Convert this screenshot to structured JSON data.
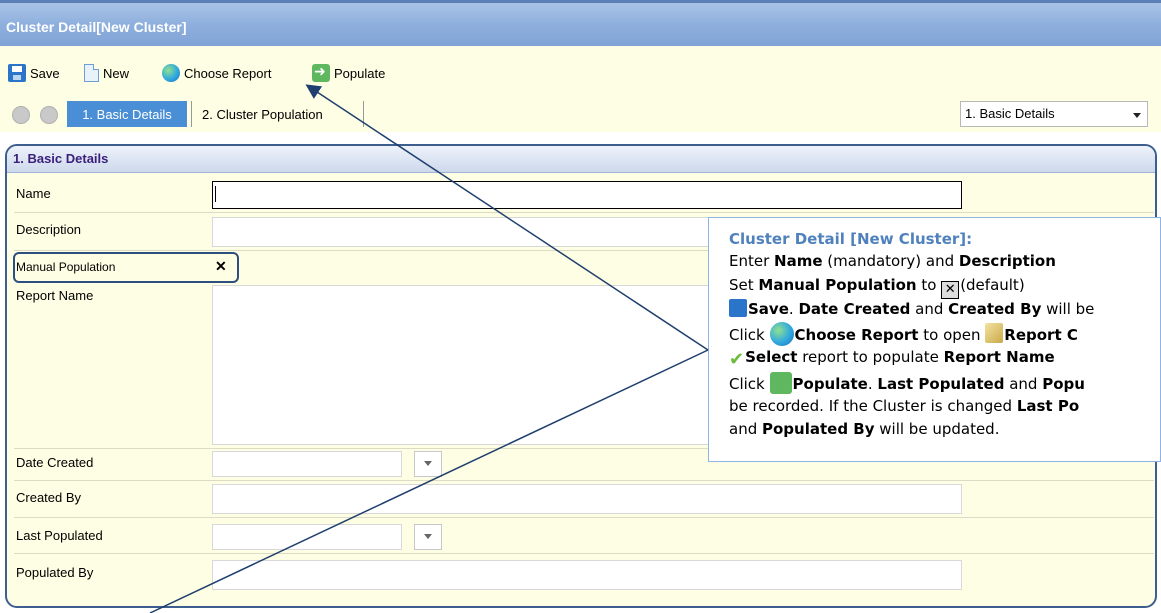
{
  "window": {
    "title": "Cluster Detail[New Cluster]"
  },
  "toolbar": {
    "save_label": "Save",
    "new_label": "New",
    "choose_report_label": "Choose Report",
    "populate_label": "Populate"
  },
  "nav": {
    "tab_basic": "1. Basic Details",
    "tab_population": "2. Cluster Population",
    "select_value": "1. Basic Details"
  },
  "panel": {
    "title": "1. Basic Details",
    "fields": {
      "name": "Name",
      "description": "Description",
      "manual_population": "Manual Population",
      "report_name": "Report Name",
      "date_created": "Date Created",
      "created_by": "Created By",
      "last_populated": "Last Populated",
      "populated_by": "Populated By"
    },
    "manual_population_value": "✕"
  },
  "callout": {
    "title": "Cluster Detail [New Cluster]:",
    "l2_a": "Enter ",
    "l2_b": "Name",
    "l2_c": " (mandatory) and ",
    "l2_d": "Description",
    "l3_a": "Set ",
    "l3_b": "Manual Population",
    "l3_c": " to ",
    "l3_d": "(default)",
    "l4_a": "Save",
    "l4_b": ". ",
    "l4_c": "Date Created",
    "l4_d": " and ",
    "l4_e": "Created By",
    "l4_f": " will be",
    "l5_a": "Click ",
    "l5_b": "Choose Report",
    "l5_c": " to open ",
    "l5_d": "Report C",
    "l6_a": "Select",
    "l6_b": " report to populate ",
    "l6_c": "Report Name",
    "l7_a": "Click ",
    "l7_b": "Populate",
    "l7_c": ". ",
    "l7_d": "Last Populated",
    "l7_e": " and ",
    "l7_f": "Popu",
    "l8_a": "be recorded. If the Cluster is changed ",
    "l8_b": "Last Po",
    "l9_a": "and ",
    "l9_b": "Populated By",
    "l9_c": " will be updated."
  }
}
